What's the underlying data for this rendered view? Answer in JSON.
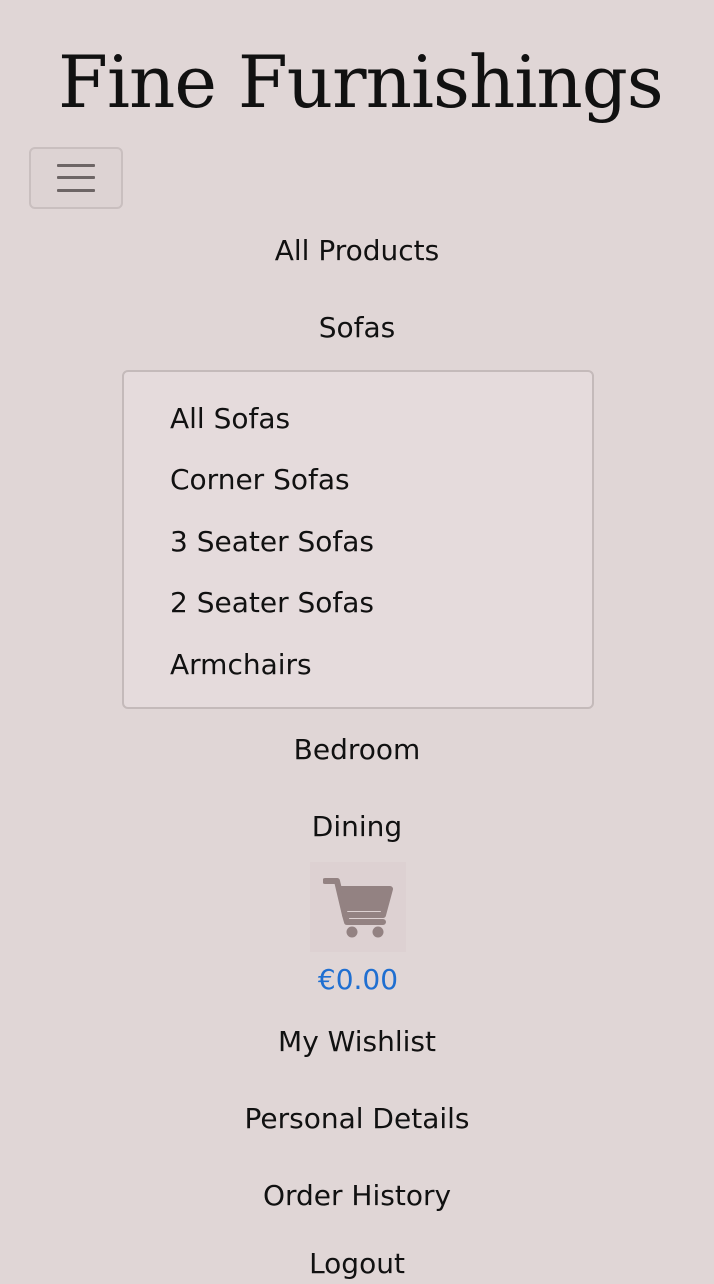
{
  "header": {
    "brand": "Fine Furnishings"
  },
  "nav": {
    "toggler_icon": "hamburger-menu-icon",
    "items": [
      {
        "label": "All Products"
      },
      {
        "label": "Sofas"
      },
      {
        "label": "Bedroom"
      },
      {
        "label": "Dining"
      }
    ],
    "sofas_dropdown": [
      {
        "label": "All Sofas"
      },
      {
        "label": "Corner Sofas"
      },
      {
        "label": "3 Seater Sofas"
      },
      {
        "label": "2 Seater Sofas"
      },
      {
        "label": "Armchairs"
      }
    ],
    "cart": {
      "icon": "shopping-cart-icon",
      "total": "€0.00"
    },
    "account_items": [
      {
        "label": "My Wishlist"
      },
      {
        "label": "Personal Details"
      },
      {
        "label": "Order History"
      },
      {
        "label": "Logout"
      }
    ]
  },
  "colors": {
    "background": "#e0d6d6",
    "dropdown_background": "#e5dbdc",
    "cart_icon": "#938282",
    "cart_total": "#1f6fd1"
  }
}
